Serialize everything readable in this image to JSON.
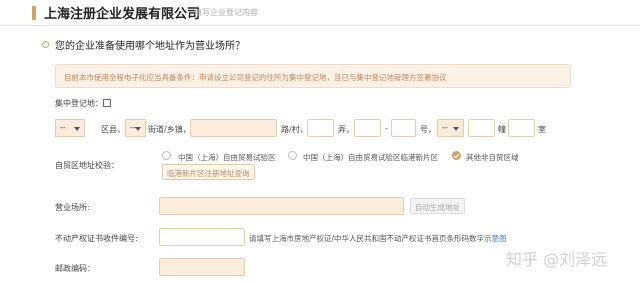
{
  "header": {
    "title": "上海注册企业发展有限公司",
    "subtitle": "填写企业登记内容"
  },
  "question": "您的企业准备使用哪个地址作为营业场所？",
  "notice": "目前本市使用全程电子化应当具备条件：申请设立公司登记的住所为集中登记地，且已与集中登记地管理方签署协议",
  "central": {
    "label": "集中登记地："
  },
  "address": {
    "district_value": "--",
    "district_suffix": "区县，",
    "street_value": "--",
    "street_suffix": "街道/乡镇，",
    "road_suffix": "路/村，",
    "lane_suffix": "弄，",
    "dash": "-",
    "number_suffix": "号，",
    "room_value": "--",
    "building_suffix": "幢",
    "room_suffix": "室"
  },
  "ftz": {
    "label": "自贸区地址校验：",
    "options": [
      "中国（上海）自由贸易试验区",
      "中国（上海）自由贸易试验区临港新片区",
      "其他非自贸区域"
    ],
    "selected_index": 2,
    "query_button": "临港新片区注册地址查询"
  },
  "business_place": {
    "label": "营业场所:",
    "generate_button": "自动生成地址"
  },
  "property_cert": {
    "label": "不动产权证书收件编号:",
    "hint": "请填写上海市房地产权证/中华人民共和国不动产权证书首页条形码数字",
    "hint_link": "示意图"
  },
  "postal": {
    "label": "邮政编码："
  },
  "watermark": "知乎 @刘泽远",
  "colors": {
    "accent": "#c9a46b",
    "peach_bg": "#fbecdc",
    "notice_text": "#c0885a",
    "link": "#4a7fc1"
  }
}
